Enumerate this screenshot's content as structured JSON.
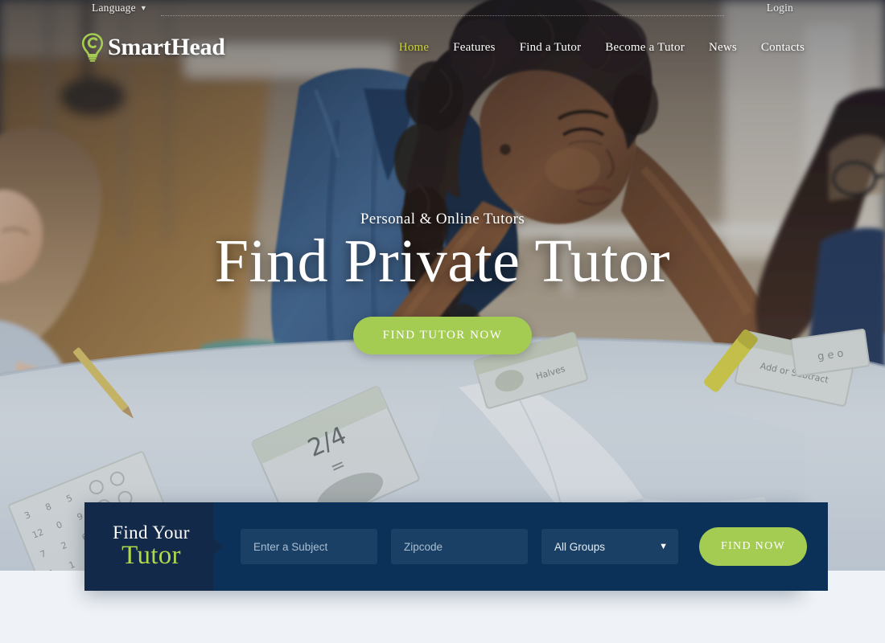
{
  "topbar": {
    "language_label": "Language",
    "language_chevron_icon": "chevron-down-icon",
    "login_label": "Login"
  },
  "brand": {
    "name": "SmartHead",
    "logo_icon": "lightbulb-icon",
    "logo_color": "#a5cc52"
  },
  "nav": {
    "items": [
      {
        "label": "Home",
        "active": true
      },
      {
        "label": "Features",
        "active": false
      },
      {
        "label": "Find a Tutor",
        "active": false
      },
      {
        "label": "Become a Tutor",
        "active": false
      },
      {
        "label": "News",
        "active": false
      },
      {
        "label": "Contacts",
        "active": false
      }
    ],
    "active_color": "#c9cf3c"
  },
  "hero": {
    "subtitle": "Personal & Online Tutors",
    "title": "Find Private Tutor",
    "cta_label": "FIND TUTOR NOW",
    "cta_color": "#a5cc52"
  },
  "search": {
    "label_line1": "Find Your",
    "label_line2": "Tutor",
    "subject_placeholder": "Enter a Subject",
    "subject_value": "",
    "zipcode_placeholder": "Zipcode",
    "zipcode_value": "",
    "group_selected": "All Groups",
    "group_options": [
      "All Groups"
    ],
    "group_chevron_icon": "chevron-down-icon",
    "submit_label": "FIND NOW",
    "panel_dark_color": "#12294a",
    "panel_color": "#0c3158",
    "field_color": "#1b4066",
    "accent_color": "#a5cc52",
    "label_accent_color": "#b0d84e"
  },
  "page": {
    "background_color": "#eff3f7"
  }
}
